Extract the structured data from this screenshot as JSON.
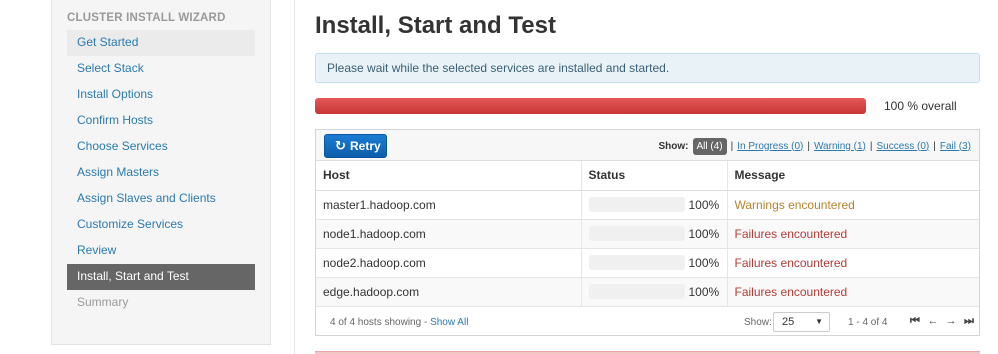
{
  "sidebar": {
    "title": "CLUSTER INSTALL WIZARD",
    "items": [
      {
        "label": "Get Started",
        "state": "done"
      },
      {
        "label": "Select Stack",
        "state": "link"
      },
      {
        "label": "Install Options",
        "state": "link"
      },
      {
        "label": "Confirm Hosts",
        "state": "link"
      },
      {
        "label": "Choose Services",
        "state": "link"
      },
      {
        "label": "Assign Masters",
        "state": "link"
      },
      {
        "label": "Assign Slaves and Clients",
        "state": "link"
      },
      {
        "label": "Customize Services",
        "state": "link"
      },
      {
        "label": "Review",
        "state": "link"
      },
      {
        "label": "Install, Start and Test",
        "state": "active"
      },
      {
        "label": "Summary",
        "state": "disabled"
      }
    ]
  },
  "main": {
    "title": "Install, Start and Test",
    "alert": "Please wait while the selected services are installed and started.",
    "overall_progress": 1.0,
    "overall_label": "100 % overall"
  },
  "toolbar": {
    "retry_label": "Retry",
    "show_label": "Show:",
    "filters": {
      "all": "All (4)",
      "in_progress": "In Progress (0)",
      "warning": "Warning (1)",
      "success": "Success (0)",
      "fail": "Fail (3)"
    }
  },
  "table": {
    "headers": {
      "host": "Host",
      "status": "Status",
      "message": "Message"
    },
    "rows": [
      {
        "host": "master1.hadoop.com",
        "progress": 1.0,
        "percent": "100%",
        "message": "Warnings encountered",
        "kind": "warn"
      },
      {
        "host": "node1.hadoop.com",
        "progress": 1.0,
        "percent": "100%",
        "message": "Failures encountered",
        "kind": "fail"
      },
      {
        "host": "node2.hadoop.com",
        "progress": 1.0,
        "percent": "100%",
        "message": "Failures encountered",
        "kind": "fail"
      },
      {
        "host": "edge.hadoop.com",
        "progress": 1.0,
        "percent": "100%",
        "message": "Failures encountered",
        "kind": "fail"
      }
    ]
  },
  "footer": {
    "count_text": "4 of 4 hosts showing - ",
    "show_all": "Show All",
    "show_label": "Show:",
    "page_size": "25",
    "range": "1 - 4 of 4"
  },
  "colors": {
    "accent_blue": "#1b7cd2",
    "fail_red": "#c93434",
    "warn_orange": "#ee9a12",
    "active_item": "#666666"
  }
}
